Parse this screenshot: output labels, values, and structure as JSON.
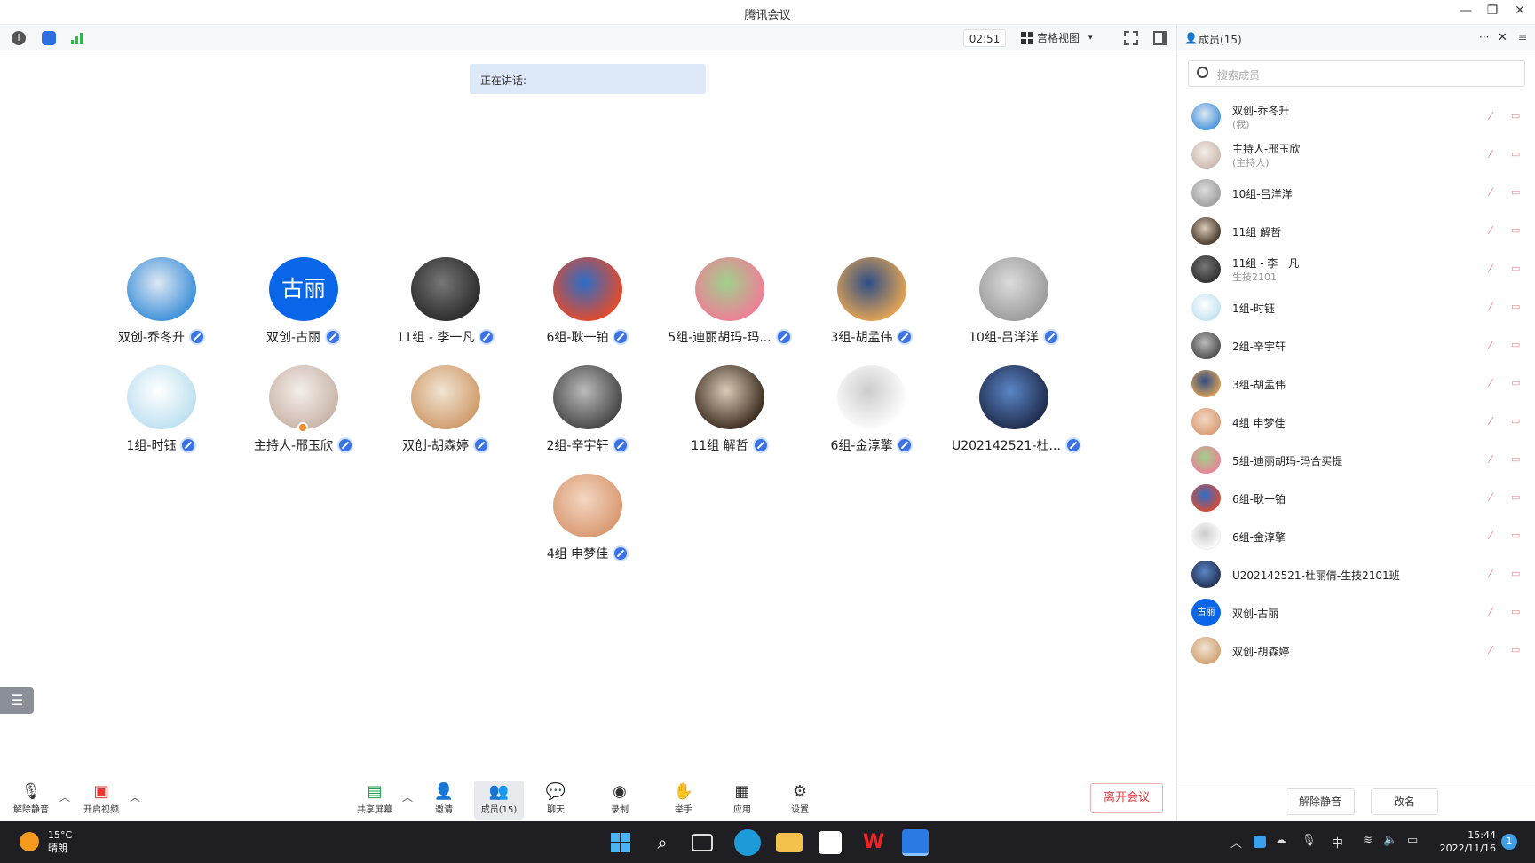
{
  "window": {
    "title": "腾讯会议",
    "minimize": "—",
    "restore": "❐",
    "close": "✕"
  },
  "toolbar": {
    "timer": "02:51",
    "view_label": "宫格视图",
    "view_caret": "▾"
  },
  "speaking": {
    "label": "正在讲话:"
  },
  "tiles": [
    {
      "name": "双创-乔冬升",
      "avatar": "photo",
      "colors": [
        "#3b8fd9",
        "#dfe8f3"
      ]
    },
    {
      "name": "双创-古丽",
      "avatar": "text",
      "text": "古丽"
    },
    {
      "name": "11组 - 李一凡",
      "avatar": "photo",
      "colors": [
        "#2a2a2a",
        "#777777"
      ]
    },
    {
      "name": "6组-耿一铂",
      "avatar": "photo",
      "colors": [
        "#e84a27",
        "#2b6ec9"
      ]
    },
    {
      "name": "5组-迪丽胡玛-玛...",
      "avatar": "photo",
      "colors": [
        "#f07c97",
        "#9fd18c"
      ]
    },
    {
      "name": "3组-胡孟伟",
      "avatar": "photo",
      "colors": [
        "#e7a653",
        "#2e4e86"
      ]
    },
    {
      "name": "10组-吕洋洋",
      "avatar": "photo",
      "colors": [
        "#9a9a9a",
        "#dcdcdc"
      ]
    },
    {
      "name": "1组-时钰",
      "avatar": "photo",
      "colors": [
        "#bde0f0",
        "#ffffff"
      ]
    },
    {
      "name": "主持人-邢玉欣",
      "avatar": "photo",
      "colors": [
        "#c9b4a8",
        "#f4eeea"
      ],
      "host": true
    },
    {
      "name": "双创-胡森婷",
      "avatar": "photo",
      "colors": [
        "#cf9a6a",
        "#f1e4d2"
      ]
    },
    {
      "name": "2组-辛宇轩",
      "avatar": "photo",
      "colors": [
        "#444444",
        "#bbbbbb"
      ]
    },
    {
      "name": "11组 解哲",
      "avatar": "photo",
      "colors": [
        "#3a2a1e",
        "#d9cbb7"
      ]
    },
    {
      "name": "6组-金淳擎",
      "avatar": "photo",
      "colors": [
        "#ffffff",
        "#cccccc"
      ]
    },
    {
      "name": "U202142521-杜...",
      "avatar": "photo",
      "colors": [
        "#1e2a4a",
        "#5a86c6"
      ]
    },
    {
      "name": "4组 申梦佳",
      "avatar": "photo",
      "colors": [
        "#d89870",
        "#f3d7c2"
      ]
    }
  ],
  "controls": {
    "unmute": "解除静音",
    "video": "开启视频",
    "share": "共享屏幕",
    "invite": "邀请",
    "members": "成员(15)",
    "chat": "聊天",
    "record": "录制",
    "raise_hand": "举手",
    "apps": "应用",
    "settings": "设置",
    "leave": "离开会议"
  },
  "panel": {
    "title": "成员(15)",
    "more": "···",
    "close": "✕",
    "search_placeholder": "搜索成员",
    "members": [
      {
        "name": "双创-乔冬升",
        "sub": "(我)",
        "colors": [
          "#3b8fd9",
          "#dfe8f3"
        ]
      },
      {
        "name": "主持人-邢玉欣",
        "sub": "(主持人)",
        "colors": [
          "#c9b4a8",
          "#f4eeea"
        ]
      },
      {
        "name": "10组-吕洋洋",
        "sub": "",
        "colors": [
          "#9a9a9a",
          "#dcdcdc"
        ]
      },
      {
        "name": "11组 解哲",
        "sub": "",
        "colors": [
          "#3a2a1e",
          "#d9cbb7"
        ]
      },
      {
        "name": "11组 - 李一凡",
        "sub": "生技2101",
        "colors": [
          "#2a2a2a",
          "#777777"
        ]
      },
      {
        "name": "1组-时钰",
        "sub": "",
        "colors": [
          "#bde0f0",
          "#ffffff"
        ]
      },
      {
        "name": "2组-辛宇轩",
        "sub": "",
        "colors": [
          "#444444",
          "#bbbbbb"
        ]
      },
      {
        "name": "3组-胡孟伟",
        "sub": "",
        "colors": [
          "#e7a653",
          "#2e4e86"
        ]
      },
      {
        "name": "4组 申梦佳",
        "sub": "",
        "colors": [
          "#d89870",
          "#f3d7c2"
        ]
      },
      {
        "name": "5组-迪丽胡玛-玛合买提",
        "sub": "",
        "colors": [
          "#f07c97",
          "#9fd18c"
        ]
      },
      {
        "name": "6组-耿一铂",
        "sub": "",
        "colors": [
          "#e84a27",
          "#2b6ec9"
        ]
      },
      {
        "name": "6组-金淳擎",
        "sub": "",
        "colors": [
          "#ffffff",
          "#cccccc"
        ]
      },
      {
        "name": "U202142521-杜丽倩-生技2101班",
        "sub": "",
        "colors": [
          "#1e2a4a",
          "#5a86c6"
        ]
      },
      {
        "name": "双创-古丽",
        "sub": "",
        "text": "古丽"
      },
      {
        "name": "双创-胡森婷",
        "sub": "",
        "colors": [
          "#cf9a6a",
          "#f1e4d2"
        ]
      }
    ],
    "footer": {
      "unmute_all": "解除静音",
      "rename": "改名"
    }
  },
  "taskbar": {
    "temperature": "15°C",
    "weather": "晴朗",
    "ime": "中",
    "time": "15:44",
    "date": "2022/11/16",
    "notifications": "1"
  },
  "colors": {
    "accent": "#0a66e8",
    "speaking_bg": "#dde9f8",
    "leave": "#e4393c",
    "taskbar": "#1f1f23"
  }
}
